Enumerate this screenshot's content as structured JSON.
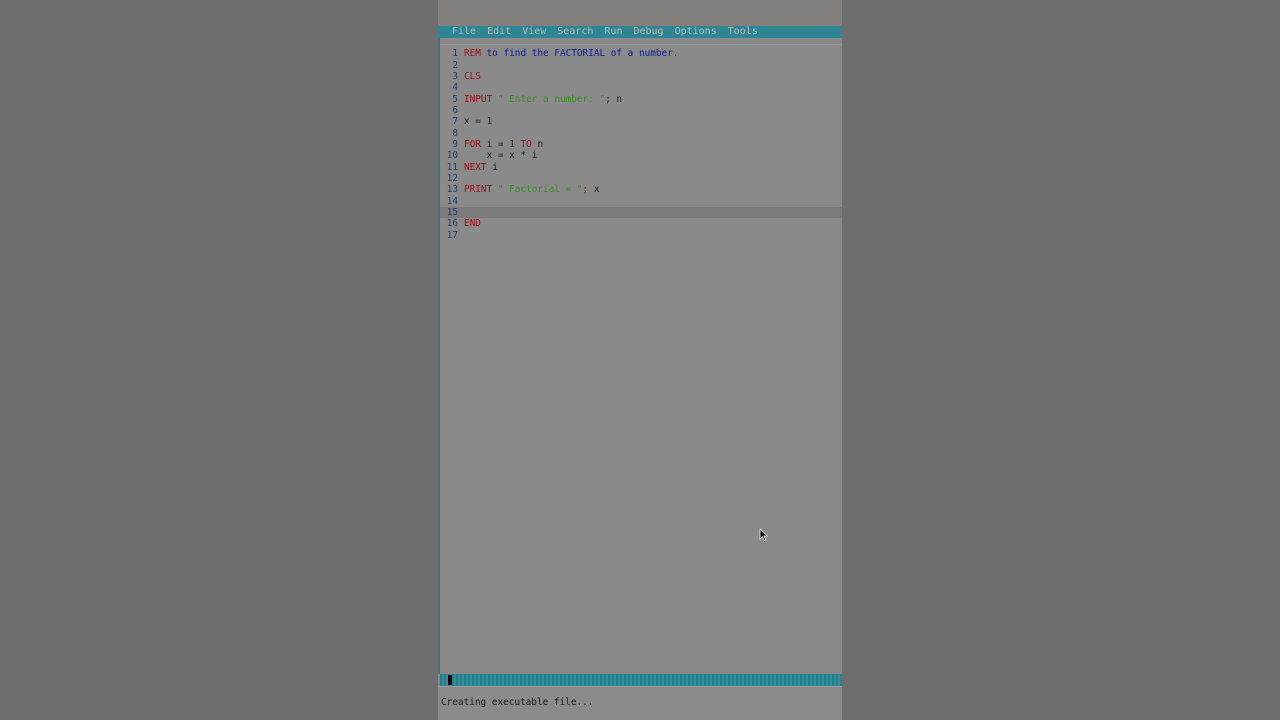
{
  "menu": {
    "items": [
      "File",
      "Edit",
      "View",
      "Search",
      "Run",
      "Debug",
      "Options",
      "Tools"
    ]
  },
  "editor": {
    "current_line": 15,
    "lines": [
      {
        "n": "1",
        "tokens": [
          {
            "t": "REM",
            "c": "kw"
          },
          {
            "t": " to find the FACTORIAL of a number.",
            "c": "cm"
          }
        ]
      },
      {
        "n": "2",
        "tokens": []
      },
      {
        "n": "3",
        "tokens": [
          {
            "t": "CLS",
            "c": "kw"
          }
        ]
      },
      {
        "n": "4",
        "tokens": []
      },
      {
        "n": "5",
        "tokens": [
          {
            "t": "INPUT",
            "c": "kw"
          },
          {
            "t": " \" Enter a number: \"",
            "c": "str"
          },
          {
            "t": "; n",
            "c": "id"
          }
        ]
      },
      {
        "n": "6",
        "tokens": []
      },
      {
        "n": "7",
        "tokens": [
          {
            "t": "x = 1",
            "c": "id"
          }
        ]
      },
      {
        "n": "8",
        "tokens": []
      },
      {
        "n": "9",
        "tokens": [
          {
            "t": "FOR",
            "c": "kw"
          },
          {
            "t": " i = 1 ",
            "c": "id"
          },
          {
            "t": "TO",
            "c": "kw"
          },
          {
            "t": " n",
            "c": "id"
          }
        ]
      },
      {
        "n": "10",
        "tokens": [
          {
            "t": "    x = x * i",
            "c": "id"
          }
        ]
      },
      {
        "n": "11",
        "tokens": [
          {
            "t": "NEXT",
            "c": "kw"
          },
          {
            "t": " i",
            "c": "id"
          }
        ]
      },
      {
        "n": "12",
        "tokens": []
      },
      {
        "n": "13",
        "tokens": [
          {
            "t": "PRINT",
            "c": "kw"
          },
          {
            "t": " \" Factorial = \"",
            "c": "str"
          },
          {
            "t": "; x",
            "c": "id"
          }
        ]
      },
      {
        "n": "14",
        "tokens": []
      },
      {
        "n": "15",
        "tokens": []
      },
      {
        "n": "16",
        "tokens": [
          {
            "t": "END",
            "c": "kw"
          }
        ]
      },
      {
        "n": "17",
        "tokens": []
      }
    ]
  },
  "message": {
    "text": "Creating executable file..."
  },
  "colors": {
    "menu_bar": "#2e8593",
    "keyword": "#9b0e18",
    "comment": "#0d1a9c",
    "string": "#3e8a2e"
  },
  "icons": {
    "pointer": "mouse-pointer-icon"
  }
}
